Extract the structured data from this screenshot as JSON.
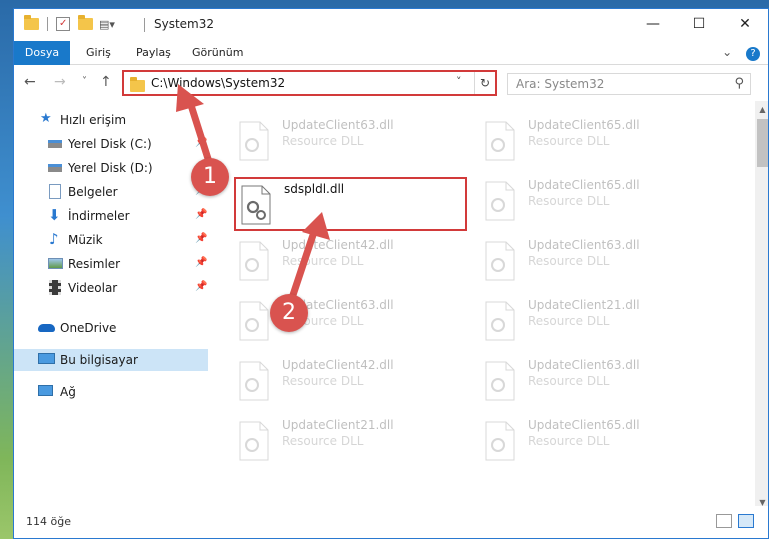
{
  "window": {
    "title": "System32",
    "controls": {
      "minimize": "—",
      "maximize": "☐",
      "close": "✕"
    }
  },
  "ribbon": {
    "tabs": [
      "Dosya",
      "Giriş",
      "Paylaş",
      "Görünüm"
    ],
    "expand_icon": "chevron-down-icon",
    "help_icon": "?"
  },
  "nav": {
    "back": "←",
    "forward": "→",
    "recent": "˅",
    "up": "↑",
    "address": "C:\\Windows\\System32",
    "address_chevron": "˅",
    "refresh": "↻",
    "search_placeholder": "Ara: System32",
    "search_icon": "⚲"
  },
  "sidebar": {
    "items": [
      {
        "label": "Hızlı erişim",
        "icon": "star-icon",
        "pinned": false
      },
      {
        "label": "Yerel Disk (C:)",
        "icon": "drive-icon",
        "pinned": true
      },
      {
        "label": "Yerel Disk (D:)",
        "icon": "drive-icon",
        "pinned": true
      },
      {
        "label": "Belgeler",
        "icon": "document-icon",
        "pinned": true
      },
      {
        "label": "İndirmeler",
        "icon": "download-icon",
        "pinned": true
      },
      {
        "label": "Müzik",
        "icon": "music-icon",
        "pinned": true
      },
      {
        "label": "Resimler",
        "icon": "picture-icon",
        "pinned": true
      },
      {
        "label": "Videolar",
        "icon": "video-icon",
        "pinned": true
      },
      {
        "label": "OneDrive",
        "icon": "cloud-icon",
        "pinned": false
      },
      {
        "label": "Bu bilgisayar",
        "icon": "computer-icon",
        "pinned": false,
        "selected": true
      },
      {
        "label": "Ağ",
        "icon": "network-icon",
        "pinned": false
      }
    ],
    "pin_glyph": "📌"
  },
  "files": {
    "background": [
      {
        "name": "UpdateClient63.dll",
        "type": "Resource DLL"
      },
      {
        "name": "UpdateClient65.dll",
        "type": "Resource DLL"
      },
      {
        "name": "UpdateClient65.dll",
        "type": "Resource DLL"
      },
      {
        "name": "UpdateClient42.dll",
        "type": "Resource DLL"
      },
      {
        "name": "UpdateClient63.dll",
        "type": "Resource DLL"
      },
      {
        "name": "UpdateClient63.dll",
        "type": "Resource DLL"
      },
      {
        "name": "UpdateClient21.dll",
        "type": "Resource DLL"
      },
      {
        "name": "UpdateClient42.dll",
        "type": "Resource DLL"
      },
      {
        "name": "UpdateClient63.dll",
        "type": "Resource DLL"
      },
      {
        "name": "UpdateClient21.dll",
        "type": "Resource DLL"
      },
      {
        "name": "UpdateClient65.dll",
        "type": "Resource DLL"
      }
    ],
    "highlighted": {
      "name": "sdspldl.dll"
    }
  },
  "status": {
    "count": "114 öğe"
  },
  "annotations": {
    "step1": "1",
    "step2": "2",
    "color": "#d9534f"
  }
}
